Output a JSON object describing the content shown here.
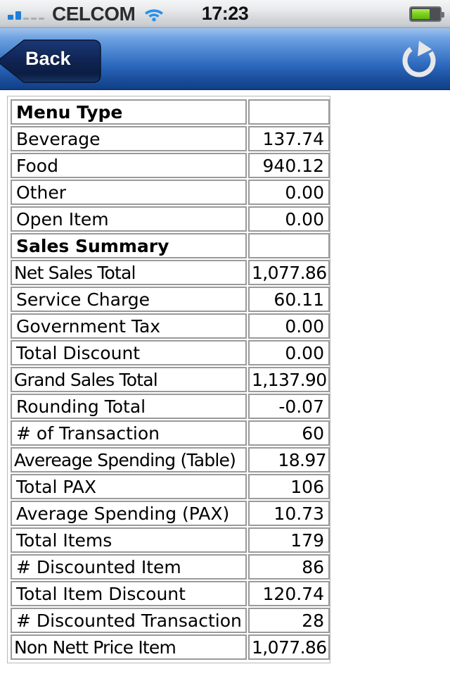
{
  "status_bar": {
    "carrier": "CELCOM",
    "time": "17:23",
    "signal_icon": "signal-bars-icon",
    "signal_bars_filled": 2,
    "signal_bars_total": 5,
    "wifi_icon": "wifi-icon",
    "battery_icon": "battery-icon",
    "battery_level_percent": 66
  },
  "nav_bar": {
    "back_label": "Back",
    "back_icon": "back-arrow-icon",
    "refresh_icon": "refresh-icon",
    "accent_color": "#2f6cc0",
    "button_color": "#12295c"
  },
  "report": {
    "rows": [
      {
        "label": "Menu Type",
        "value": "",
        "section": true,
        "tight": false
      },
      {
        "label": "Beverage",
        "value": "137.74",
        "section": false,
        "tight": false
      },
      {
        "label": "Food",
        "value": "940.12",
        "section": false,
        "tight": false
      },
      {
        "label": "Other",
        "value": "0.00",
        "section": false,
        "tight": false
      },
      {
        "label": "Open Item",
        "value": "0.00",
        "section": false,
        "tight": false
      },
      {
        "label": "Sales Summary",
        "value": "",
        "section": true,
        "tight": false
      },
      {
        "label": "Net Sales Total",
        "value": "1,077.86",
        "section": false,
        "tight": true
      },
      {
        "label": "Service Charge",
        "value": "60.11",
        "section": false,
        "tight": false
      },
      {
        "label": "Government Tax",
        "value": "0.00",
        "section": false,
        "tight": false
      },
      {
        "label": "Total Discount",
        "value": "0.00",
        "section": false,
        "tight": false
      },
      {
        "label": "Grand Sales Total",
        "value": "1,137.90",
        "section": false,
        "tight": true
      },
      {
        "label": "Rounding Total",
        "value": "-0.07",
        "section": false,
        "tight": false
      },
      {
        "label": "# of Transaction",
        "value": "60",
        "section": false,
        "tight": false
      },
      {
        "label": "Avereage Spending (Table)",
        "value": "18.97",
        "section": false,
        "tight": true
      },
      {
        "label": "Total PAX",
        "value": "106",
        "section": false,
        "tight": false
      },
      {
        "label": "Average Spending (PAX)",
        "value": "10.73",
        "section": false,
        "tight": false
      },
      {
        "label": "Total Items",
        "value": "179",
        "section": false,
        "tight": false
      },
      {
        "label": "# Discounted Item",
        "value": "86",
        "section": false,
        "tight": false
      },
      {
        "label": "Total Item Discount",
        "value": "120.74",
        "section": false,
        "tight": false
      },
      {
        "label": "# Discounted Transaction",
        "value": "28",
        "section": false,
        "tight": false
      },
      {
        "label": "Non Nett Price Item",
        "value": "1,077.86",
        "section": false,
        "tight": true
      }
    ]
  }
}
